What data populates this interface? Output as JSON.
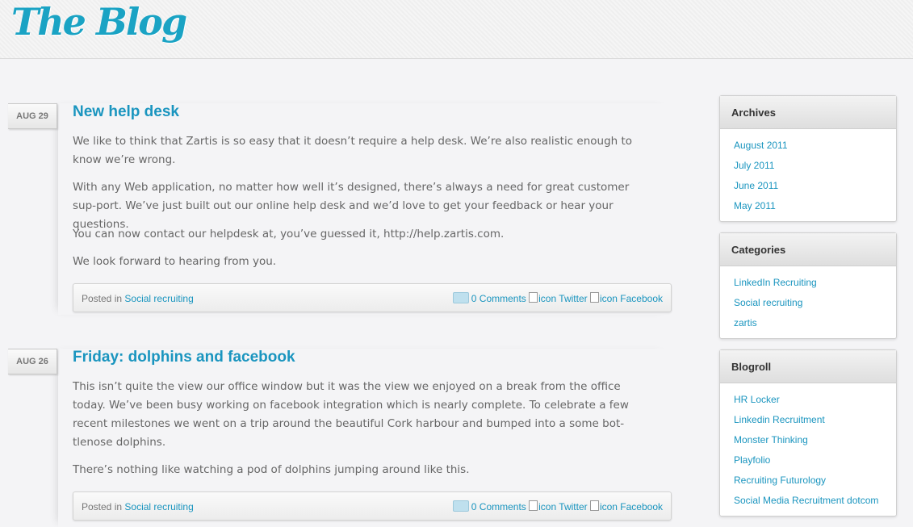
{
  "site": {
    "title": "The Blog"
  },
  "posts": [
    {
      "date": "AUG 29",
      "title": "New help desk",
      "paragraphs": [
        "We like to think that Zartis is so easy that it doesn’t require a help desk. We’re also realistic enough to know we’re wrong.",
        "With any Web application, no matter how well it’s designed, there’s always a need for great customer sup-port. We’ve just built out our online help desk and we’d love to get your feedback or hear your questions.",
        "You can now contact our helpdesk at, you’ve guessed it, http://help.zartis.com.",
        "We look forward to hearing from you."
      ],
      "posted_in_label": "Posted in",
      "category": "Social recruiting",
      "comments": "0 Comments",
      "twitter": "icon Twitter",
      "facebook": "icon Facebook"
    },
    {
      "date": "AUG 26",
      "title": "Friday: dolphins and facebook",
      "paragraphs": [
        "This isn’t quite the view our office window but it was the view we enjoyed on a break from the office today. We’ve been busy working on facebook integration which is nearly complete. To celebrate a few recent milestones we went on a trip around the beautiful Cork harbour and bumped into a some bot-tlenose dolphins.",
        "There’s nothing like watching a pod of dolphins jumping around like this."
      ],
      "posted_in_label": "Posted in",
      "category": "Social recruiting",
      "comments": "0 Comments",
      "twitter": "icon Twitter",
      "facebook": "icon Facebook"
    }
  ],
  "sidebar": {
    "archives": {
      "title": "Archives",
      "items": [
        "August 2011",
        "July 2011",
        "June 2011",
        "May 2011"
      ]
    },
    "categories": {
      "title": "Categories",
      "items": [
        "LinkedIn Recruiting",
        "Social recruiting",
        "zartis"
      ]
    },
    "blogroll": {
      "title": "Blogroll",
      "items": [
        "HR Locker",
        "Linkedin Recruitment",
        "Monster Thinking",
        "Playfolio",
        "Recruiting Futurology",
        "Social Media Recruitment dotcom"
      ]
    }
  }
}
